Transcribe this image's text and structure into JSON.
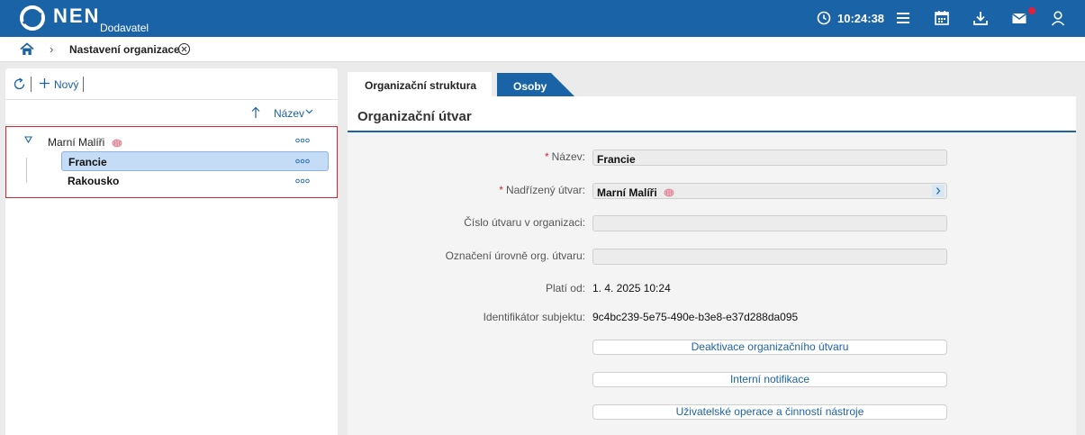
{
  "header": {
    "brand": "NEN",
    "brand_sub": "Dodavatel",
    "clock": "10:24:38"
  },
  "breadcrumb": {
    "page": "Nastavení organizace"
  },
  "left_panel": {
    "new_label": "Nový",
    "sort_label": "Název",
    "tree": {
      "root": "Marní Malíři",
      "children": [
        "Francie",
        "Rakousko"
      ],
      "selected": "Francie"
    }
  },
  "tabs": [
    {
      "label": "Organizační struktura",
      "active": true
    },
    {
      "label": "Osoby",
      "active": false
    }
  ],
  "form": {
    "title": "Organizační útvar",
    "name_label": "Název",
    "name_value": "Francie",
    "parent_label": "Nadřízený útvar",
    "parent_value": "Marní Malíři",
    "number_label": "Číslo útvaru v organizaci",
    "number_value": "",
    "level_label": "Označení úrovně org. útvaru",
    "level_value": "",
    "valid_from_label": "Platí od",
    "valid_from_value": "1. 4. 2025 10:24",
    "subject_id_label": "Identifikátor subjektu",
    "subject_id_value": "9c4bc239-5e75-490e-b3e8-e37d288da095",
    "btn_deactivate": "Deaktivace organizačního útvaru",
    "btn_notifications": "Interní notifikace",
    "btn_user_ops": "Uživatelské operace a činností nástroje"
  },
  "colors": {
    "primary": "#1b63a7",
    "required": "#cc2b36",
    "selection": "#c4dcf6"
  }
}
